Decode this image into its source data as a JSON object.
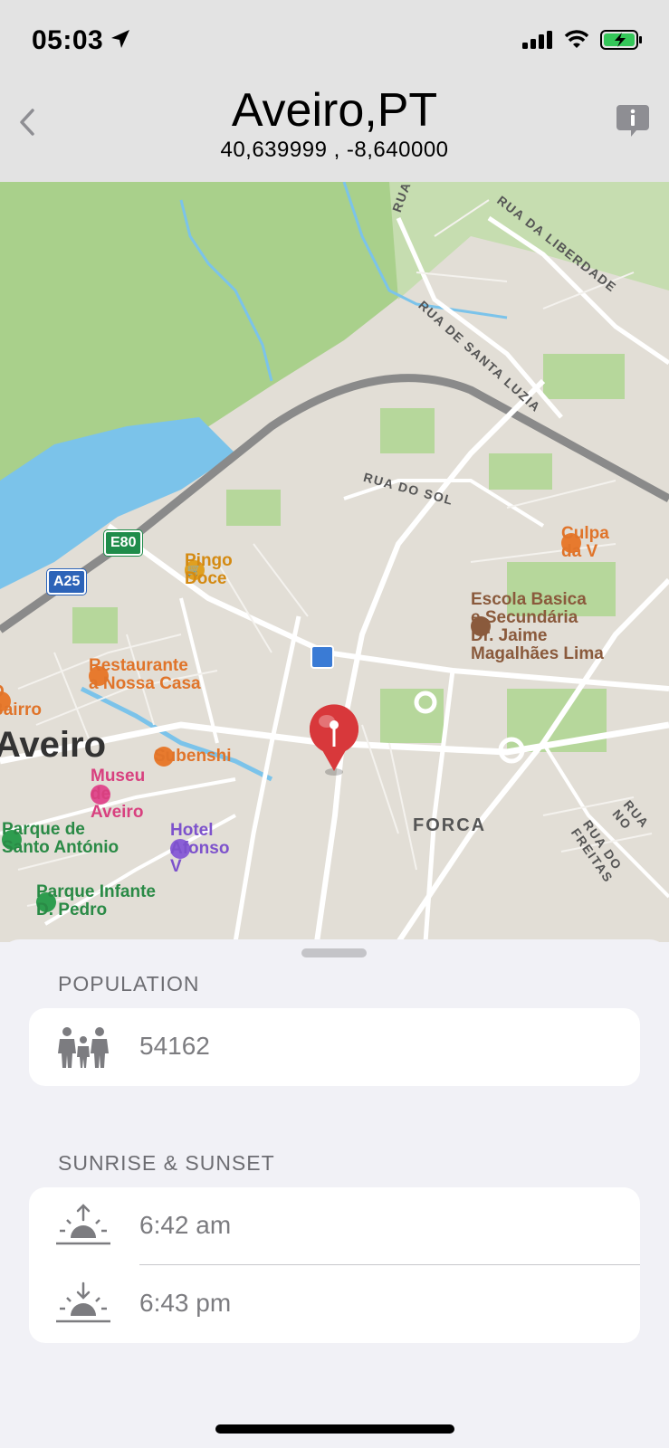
{
  "status_bar": {
    "time": "05:03"
  },
  "header": {
    "title": "Aveiro,PT",
    "coordinates": "40,639999 , -8,640000"
  },
  "map": {
    "city_label": "Aveiro",
    "area_label": "FORCA",
    "streets": [
      "RUA DA BALSEIRA",
      "RUA DA LIBERDADE",
      "RUA DE SANTA LUZIA",
      "RUA DO SOL",
      "RUA DO FREITAS",
      "RUA NO"
    ],
    "road_shields": [
      "E80",
      "A25"
    ],
    "pois": [
      {
        "name": "Pingo Doce",
        "color": "#e0a020"
      },
      {
        "name": "Restaurante\na Nossa Casa",
        "color": "#e77a2e"
      },
      {
        "name": "O Bairro",
        "color": "#e77a2e"
      },
      {
        "name": "Subenshi",
        "color": "#e77a2e"
      },
      {
        "name": "Museu de Aveiro",
        "color": "#e04c8f"
      },
      {
        "name": "Parque de\nSanto António",
        "color": "#2e9d4f"
      },
      {
        "name": "Hotel Afonso V",
        "color": "#8a5fd6"
      },
      {
        "name": "Parque Infante\nD. Pedro",
        "color": "#2e9d4f"
      },
      {
        "name": "Escola Basica\ne Secundária\nDr. Jaime\nMagalhães Lima",
        "color": "#8a5a3c"
      },
      {
        "name": "Culpa da V",
        "color": "#e77a2e"
      }
    ]
  },
  "population": {
    "heading": "POPULATION",
    "value": "54162",
    "icon": "family-icon"
  },
  "sun": {
    "heading": "SUNRISE & SUNSET",
    "sunrise": "6:42 am",
    "sunset": "6:43 pm"
  },
  "colors": {
    "water": "#7bc3ea",
    "park": "#a9d08b",
    "highway": "#8a8a8a",
    "pin": "#d8383b"
  }
}
